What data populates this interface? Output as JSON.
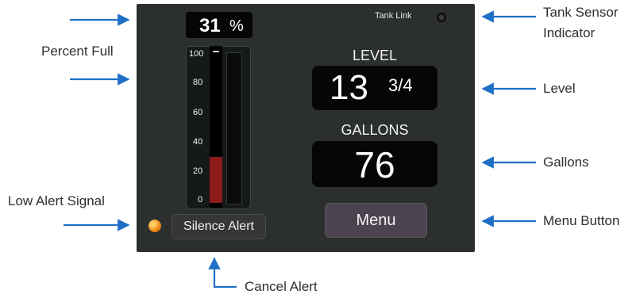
{
  "colors": {
    "panel_bg": "#2b2f2d",
    "display_bg": "#060606",
    "arrow": "#1f6fc6",
    "bar_fill": "#8b1a1a",
    "alert_light": "#f08a18",
    "menu_button": "#4b4350"
  },
  "device": {
    "percent": {
      "value": "31",
      "unit": "%"
    },
    "tank_link_label": "Tank Link",
    "sensor_icon": "sensor-indicator-icon",
    "bar": {
      "scale": [
        "100",
        "80",
        "60",
        "40",
        "20",
        "0"
      ],
      "level_percent": 31
    },
    "alert_icon": "alert-light-icon",
    "silence_button": "Silence Alert",
    "level": {
      "label": "LEVEL",
      "whole": "13",
      "fraction": "3/4"
    },
    "gallons": {
      "label": "GALLONS",
      "value": "76"
    },
    "menu_button": "Menu"
  },
  "callouts": {
    "percent_full": "Percent Full",
    "low_alert_signal": "Low Alert Signal",
    "tank_sensor_line1": "Tank Sensor",
    "tank_sensor_line2": "Indicator",
    "level": "Level",
    "gallons": "Gallons",
    "menu_button": "Menu Button",
    "cancel_alert": "Cancel Alert"
  }
}
